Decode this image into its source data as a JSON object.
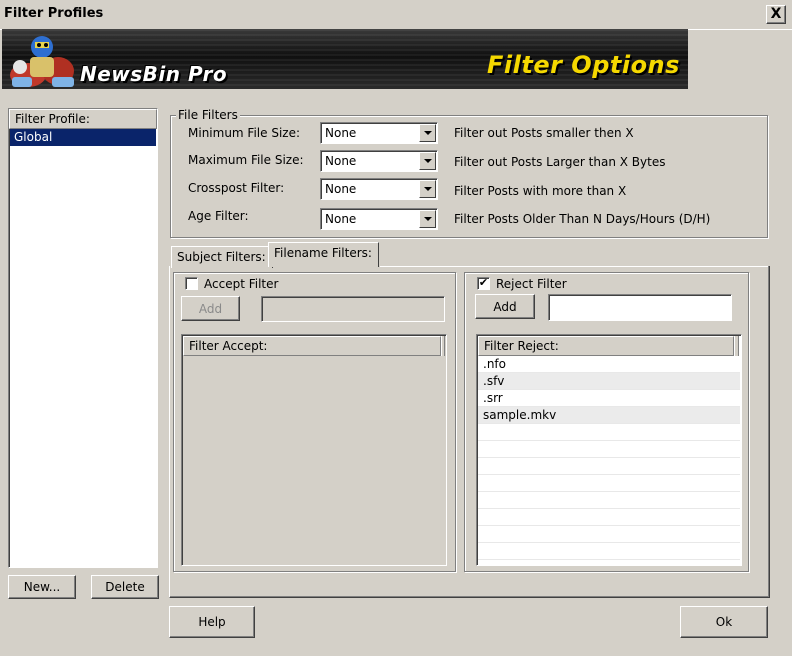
{
  "window": {
    "title": "Filter Profiles",
    "close_label": "X"
  },
  "banner": {
    "logo_text": "NewsBin Pro",
    "title": "Filter Options"
  },
  "profiles": {
    "header": "Filter Profile:",
    "items": [
      "Global"
    ],
    "new_label": "New...",
    "delete_label": "Delete"
  },
  "file_filters": {
    "legend": "File Filters",
    "rows": [
      {
        "label": "Minimum File Size:",
        "value": "None",
        "desc": "Filter out Posts smaller then X"
      },
      {
        "label": "Maximum File Size:",
        "value": "None",
        "desc": "Filter out Posts Larger than X Bytes"
      },
      {
        "label": "Crosspost Filter:",
        "value": "None",
        "desc": "Filter Posts with more than X"
      },
      {
        "label": "Age Filter:",
        "value": "None",
        "desc": "Filter Posts Older Than N Days/Hours (D/H)"
      }
    ]
  },
  "tabs": {
    "subject": "Subject Filters:",
    "filename": "Filename Filters:"
  },
  "accept": {
    "checkbox_label": "Accept Filter",
    "checked": false,
    "add_label": "Add",
    "input_value": "",
    "list_header": "Filter Accept:",
    "items": []
  },
  "reject": {
    "checkbox_label": "Reject Filter",
    "checked": true,
    "check_mark": "✔",
    "add_label": "Add",
    "input_value": "",
    "list_header": "Filter Reject:",
    "items": [
      ".nfo",
      ".sfv",
      ".srr",
      "sample.mkv"
    ]
  },
  "footer": {
    "help_label": "Help",
    "ok_label": "Ok"
  },
  "colors": {
    "selection": "#0a246a",
    "banner_title": "#f5d800",
    "dialog_bg": "#d4d0c8"
  }
}
